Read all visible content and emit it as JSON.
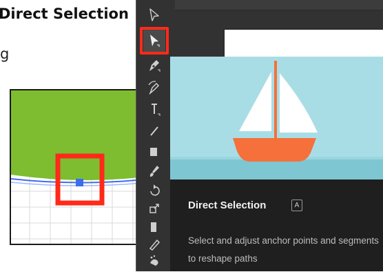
{
  "heading": "Direct Selection",
  "subtext": "g",
  "tooltip": {
    "title": "Direct Selection",
    "shortcut": "A",
    "description": "Select and adjust anchor points and segments to reshape paths"
  },
  "toolbar": {
    "tools": [
      {
        "name": "selection-tool",
        "icon": "selection-arrow-outline-icon"
      },
      {
        "name": "direct-selection-tool",
        "icon": "direct-selection-arrow-icon",
        "active": true
      },
      {
        "name": "pen-tool",
        "icon": "pen-icon"
      },
      {
        "name": "curvature-tool",
        "icon": "curvature-pen-icon"
      },
      {
        "name": "type-tool",
        "icon": "type-icon"
      },
      {
        "name": "line-tool",
        "icon": "line-segment-icon"
      },
      {
        "name": "shape-tool",
        "icon": "rectangle-icon"
      },
      {
        "name": "paintbrush-tool",
        "icon": "paintbrush-icon"
      },
      {
        "name": "rotate-tool",
        "icon": "rotate-icon"
      },
      {
        "name": "scale-tool",
        "icon": "scale-icon"
      },
      {
        "name": "width-tool",
        "icon": "width-icon"
      },
      {
        "name": "eraser-tool",
        "icon": "eraser-icon"
      },
      {
        "name": "eyedropper-tool",
        "icon": "eyedropper-icon"
      },
      {
        "name": "symbol-sprayer-tool",
        "icon": "symbol-sprayer-icon"
      }
    ]
  },
  "colors": {
    "highlight": "#ff2a1a",
    "panel_bg": "#323232",
    "tooltip_bg": "#1f1f1f",
    "sky": "#a9dde6",
    "water": "#7ec6d2",
    "boat_hull": "#f5703a",
    "sail": "#ffffff",
    "grass": "#7dbd2f",
    "anchor_point": "#3d6cf0"
  }
}
